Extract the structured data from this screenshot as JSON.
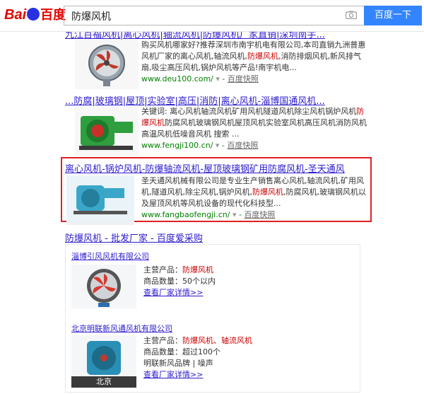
{
  "header": {
    "logo_text": "Bai",
    "logo_du": "百度",
    "query": "防爆风机",
    "search_button": "百度一下"
  },
  "results": [
    {
      "title": "九江百福风机|离心风机|轴流风机|防爆风机厂家直销|深圳南宇...",
      "snippet_parts": [
        "购买风机哪家好?推荐深圳市南宇机电有限公司,本司直销九洲普惠风机厂家的离心风机,轴流风机,",
        "防爆风机",
        ",消防排烟风机,新风排气扇,吸尘高压风机,锅炉风机等产品!南宇机电..."
      ],
      "url": "www.deu100.com/",
      "kuaizhao": "百度快照"
    },
    {
      "title": "...防腐|玻璃钢|屋顶|实验室|高压|消防|离心风机-淄博国通风机...",
      "snippet_parts": [
        "关键词: 离心风机轴流风机矿用风机隧道风机除尘风机锅炉风机",
        "防爆风机",
        "防腐风机玻璃钢风机屋顶风机实验室风机高压风机消防风机高温风机低噪音风机 搜索 ..."
      ],
      "url": "www.fengji100.cn/",
      "kuaizhao": "百度快照"
    },
    {
      "title": "离心风机-锅炉风机-防爆轴流风机-屋顶玻璃钢矿用防腐风机-圣天通风",
      "snippet_parts": [
        "圣天通风机械有限公司是专业生产销售离心风机,轴流风机,矿用风机,隧道风机,除尘风机,锅炉风机,",
        "防爆风机",
        ",防腐风机,玻璃钢风机以及屋顶风机等风机设备的现代化科技型..."
      ],
      "url": "www.fangbaofengji.cn/",
      "kuaizhao": "百度快照"
    }
  ],
  "aicai": {
    "title": "防爆风机 - 批发厂家 - 百度爱采购",
    "shops": [
      {
        "name": "淄博引风风机有限公司",
        "main_label": "主营产品：",
        "main_value": "防爆风机",
        "count_label": "商品数量：",
        "count_value": "50个以内",
        "link": "查看厂家详情>>"
      },
      {
        "name": "北京明联新风通风机有限公司",
        "main_label": "主营产品：",
        "main_value": "防爆风机、轴流风机",
        "count_label": "商品数量：",
        "count_value": "超过100个",
        "brand_label": "明联新风品牌",
        "brand_sep": "|",
        "brand_tag": "噪声",
        "link": "查看厂家详情>>",
        "img_caption": "北京"
      }
    ]
  },
  "colors": {
    "link": "#2b1bcc",
    "highlight": "#c00000",
    "url": "#008000",
    "button": "#3385ff",
    "box": "#e02020"
  }
}
